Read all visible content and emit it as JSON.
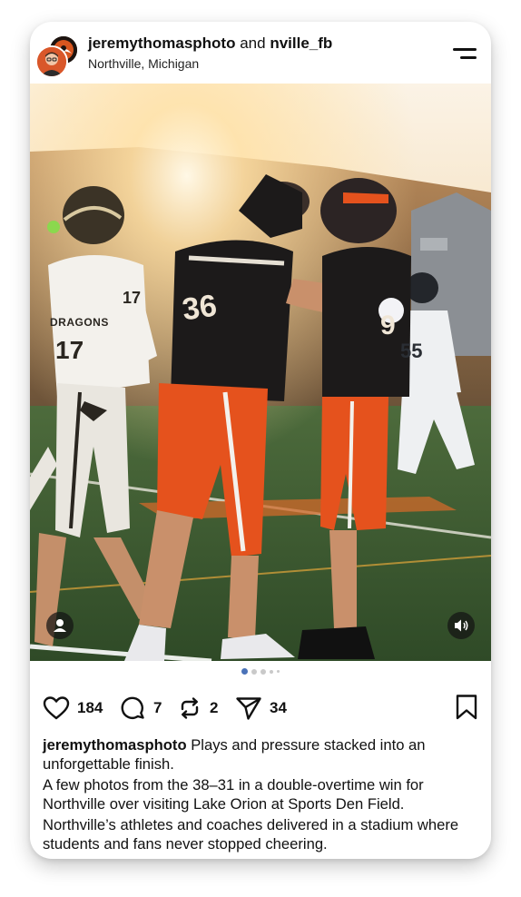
{
  "post": {
    "author": "jeremythomasphoto",
    "and_text": "and",
    "collaborator": "nville_fb",
    "location": "Northville, Michigan"
  },
  "icons": {
    "menu": "menu-icon",
    "user_tag": "user-icon",
    "sound": "speaker-icon",
    "like": "heart-icon",
    "comment": "comment-icon",
    "repost": "repost-icon",
    "share": "send-icon",
    "save": "bookmark-icon"
  },
  "carousel": {
    "total": 5,
    "active": 1
  },
  "photo_jerseys": {
    "player_left": "17",
    "player_center": "36",
    "player_right": "9",
    "player_background": "55",
    "team_text": "DRAGONS"
  },
  "stats": {
    "likes": "184",
    "comments": "7",
    "reposts": "2",
    "shares": "34"
  },
  "caption": {
    "username": "jeremythomasphoto",
    "line1": "Plays and pressure stacked into an unforgettable finish.",
    "line2": "A few photos from the 38–31 in a double-overtime win for Northville over visiting Lake Orion at Sports Den Field.",
    "line3": "Northville’s athletes and coaches delivered in a stadium where students and fans never stopped cheering."
  },
  "colors": {
    "accent": "#4a72b8",
    "northville_orange": "#e5521d",
    "jersey_black": "#1c1a1a"
  }
}
